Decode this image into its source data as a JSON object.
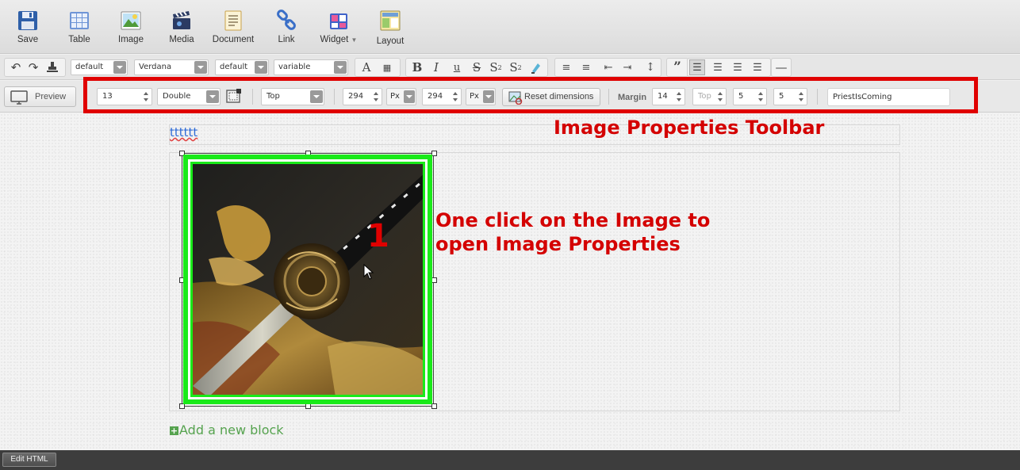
{
  "ribbon": {
    "save": "Save",
    "table": "Table",
    "image": "Image",
    "media": "Media",
    "document": "Document",
    "link": "Link",
    "widget": "Widget",
    "layout": "Layout"
  },
  "format_bar": {
    "style_select": "default",
    "font_select": "Verdana",
    "size_select": "default",
    "line_select": "variable"
  },
  "image_props": {
    "preview_label": "Preview",
    "border_width": "13",
    "border_style": "Double",
    "align": "Top",
    "width": "294",
    "width_unit": "Px",
    "height": "294",
    "height_unit": "Px",
    "reset_label": "Reset dimensions",
    "margin_label": "Margin",
    "margin_value": "14",
    "margin_side": "Top",
    "margin_val2": "5",
    "margin_val3": "5",
    "name_value": "PriestIsComing"
  },
  "canvas": {
    "block_text": "tttttt",
    "annotation_title": "Image Properties Toolbar",
    "annotation_body": "One click on the Image to open Image Properties",
    "step_number": "1",
    "add_block": "Add a new block"
  },
  "bottom": {
    "edit_html": "Edit HTML"
  },
  "colors": {
    "annotation_red": "#d40000",
    "selection_green": "#19ea19",
    "add_block_green": "#56a34f"
  }
}
